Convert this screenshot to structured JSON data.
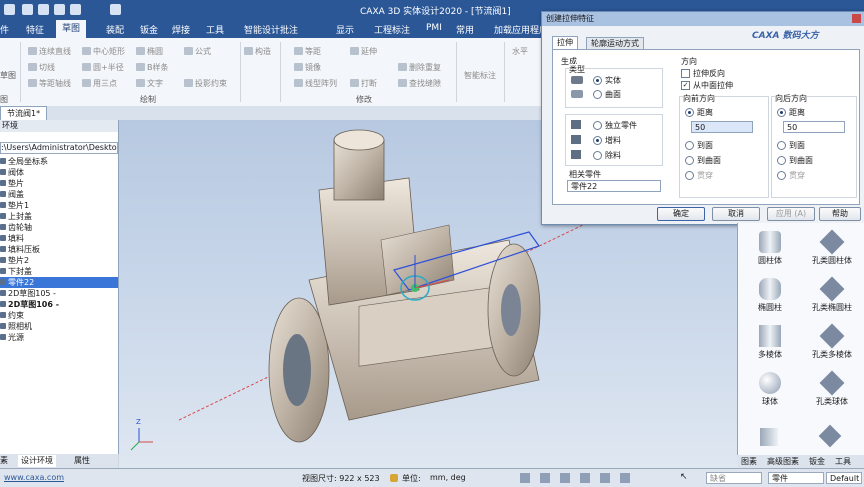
{
  "window": {
    "title": "CAXA 3D 实体设计2020 - [节流阀1]"
  },
  "menubar": {
    "items": [
      "件",
      "特征",
      "草图",
      "装配",
      "钣金",
      "焊接",
      "工具",
      "智能设计批注",
      "显示",
      "工程标注",
      "PMI",
      "常用",
      "加载应用程序"
    ],
    "active_index": 2
  },
  "ribbon": {
    "col1": [
      "连续直线",
      "切线",
      "等距轴线"
    ],
    "col2": [
      "中心矩形",
      "圆+半径",
      "用三点"
    ],
    "col3": [
      "椭圆",
      "B样条",
      "文字"
    ],
    "col4": [
      "公式",
      "投影约束"
    ],
    "col5": [
      "构造"
    ],
    "col6": [
      "等距",
      "镜像",
      "线型阵列"
    ],
    "col7": [
      "延伸",
      "打断"
    ],
    "col8": [
      "删除重复",
      "查找缝隙"
    ],
    "col9": [
      "智能标注"
    ],
    "col10": [
      "水平"
    ],
    "left_labels": [
      "草图",
      "图"
    ],
    "group_draw": "绘制",
    "group_modify": "修改"
  },
  "doc_tab": "节流阀1*",
  "left_panel": {
    "header": "环境",
    "path": ":\\Users\\Administrator\\Desktop",
    "tree": [
      {
        "label": "全局坐标系",
        "selected": false,
        "bold": false
      },
      {
        "label": "阀体",
        "selected": false,
        "bold": false
      },
      {
        "label": "垫片",
        "selected": false,
        "bold": false
      },
      {
        "label": "阀盖",
        "selected": false,
        "bold": false
      },
      {
        "label": "垫片1",
        "selected": false,
        "bold": false
      },
      {
        "label": "上封盖",
        "selected": false,
        "bold": false
      },
      {
        "label": "齿轮轴",
        "selected": false,
        "bold": false
      },
      {
        "label": "填料",
        "selected": false,
        "bold": false
      },
      {
        "label": "填料压板",
        "selected": false,
        "bold": false
      },
      {
        "label": "垫片2",
        "selected": false,
        "bold": false
      },
      {
        "label": "下封盖",
        "selected": false,
        "bold": false
      },
      {
        "label": "零件22",
        "selected": true,
        "bold": false
      },
      {
        "label": "2D草图105 -",
        "selected": false,
        "bold": false
      },
      {
        "label": "2D草图106 -",
        "selected": false,
        "bold": true
      },
      {
        "label": "约束",
        "selected": false,
        "bold": false
      },
      {
        "label": "照相机",
        "selected": false,
        "bold": false
      },
      {
        "label": "光源",
        "selected": false,
        "bold": false
      }
    ],
    "tabs": [
      "素",
      "设计环境",
      "属性"
    ]
  },
  "dialog": {
    "title": "创建拉伸特征",
    "tabs": [
      "拉伸",
      "轮廓运动方式"
    ],
    "generate_label": "生成",
    "type_label": "类型",
    "type_options": [
      {
        "label": "实体",
        "on": true
      },
      {
        "label": "曲面",
        "on": false
      }
    ],
    "part_options": [
      {
        "label": "独立零件",
        "on": false
      },
      {
        "label": "增料",
        "on": true
      },
      {
        "label": "除料",
        "on": false
      }
    ],
    "related_part_label": "相关零件",
    "related_part_value": "零件22",
    "direction_label": "方向",
    "reverse_label": "拉伸反向",
    "midplane_label": "从中面拉伸",
    "forward_label": "向前方向",
    "backward_label": "向后方向",
    "forward_options": [
      {
        "label": "距离",
        "on": true
      },
      {
        "label": "到面",
        "on": false
      },
      {
        "label": "到曲面",
        "on": false
      },
      {
        "label": "贯穿",
        "on": false
      }
    ],
    "backward_options": [
      {
        "label": "距离",
        "on": true
      },
      {
        "label": "到面",
        "on": false
      },
      {
        "label": "到曲面",
        "on": false
      },
      {
        "label": "贯穿",
        "on": false
      }
    ],
    "forward_value": "50",
    "backward_value": "50",
    "buttons": {
      "ok": "确定",
      "cancel": "取消",
      "apply": "应用 (A)",
      "help": "帮助"
    },
    "brand": "CAXA 数码大方"
  },
  "right_panel": {
    "shapes": [
      "圆柱体",
      "孔类圆柱体",
      "椭圆柱",
      "孔类椭圆柱",
      "多棱体",
      "孔类多棱体",
      "球体",
      "孔类球体"
    ],
    "tabs": [
      "图素",
      "高级图素",
      "钣金",
      "工具"
    ]
  },
  "statusbar": {
    "url": "www.caxa.com",
    "view_size": "视图尺寸: 922 x 523",
    "unit_label": "单位:",
    "unit_value": "mm, deg",
    "filter": "缺省",
    "part": "零件",
    "default": "Default"
  },
  "viewport": {
    "origin_marker": "Z"
  },
  "colors": {
    "accent": "#2b5797",
    "selection": "#3a76d8"
  }
}
